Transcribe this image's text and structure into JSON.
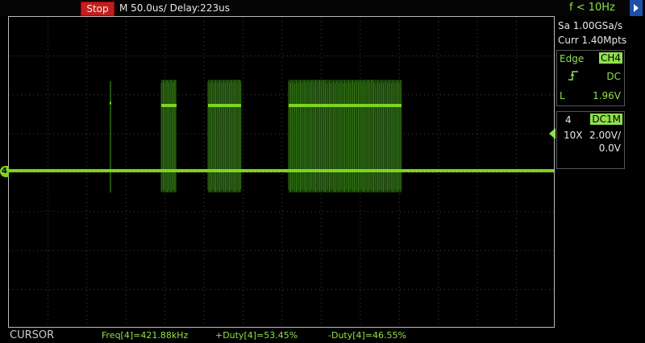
{
  "header": {
    "status": "Stop",
    "timebase": "M 50.0us/  Delay:223us",
    "trigger_freq": "f < 10Hz"
  },
  "acquisition": {
    "sample_rate": "Sa 1.00GSa/s",
    "memory_depth": "Curr 1.40Mpts"
  },
  "trigger": {
    "type": "Edge",
    "source": "CH4",
    "slope_icon": "rising-edge-icon",
    "coupling": "DC",
    "level_label": "L",
    "level": "1.96V"
  },
  "channel": {
    "number": "4",
    "coupling_impedance": "DC1M",
    "probe": "10X",
    "scale": "2.00V/",
    "offset": "0.0V",
    "marker": "4",
    "color": "#7ed321"
  },
  "footer": {
    "mode": "CURSOR",
    "freq": "Freq[4]=421.88kHz",
    "pos_duty": "+Duty[4]=53.45%",
    "neg_duty": "-Duty[4]=46.55%"
  },
  "colors": {
    "trace": "#7ed321",
    "stop": "#c21e1e",
    "trigger_marker": "#3aa0d8"
  }
}
